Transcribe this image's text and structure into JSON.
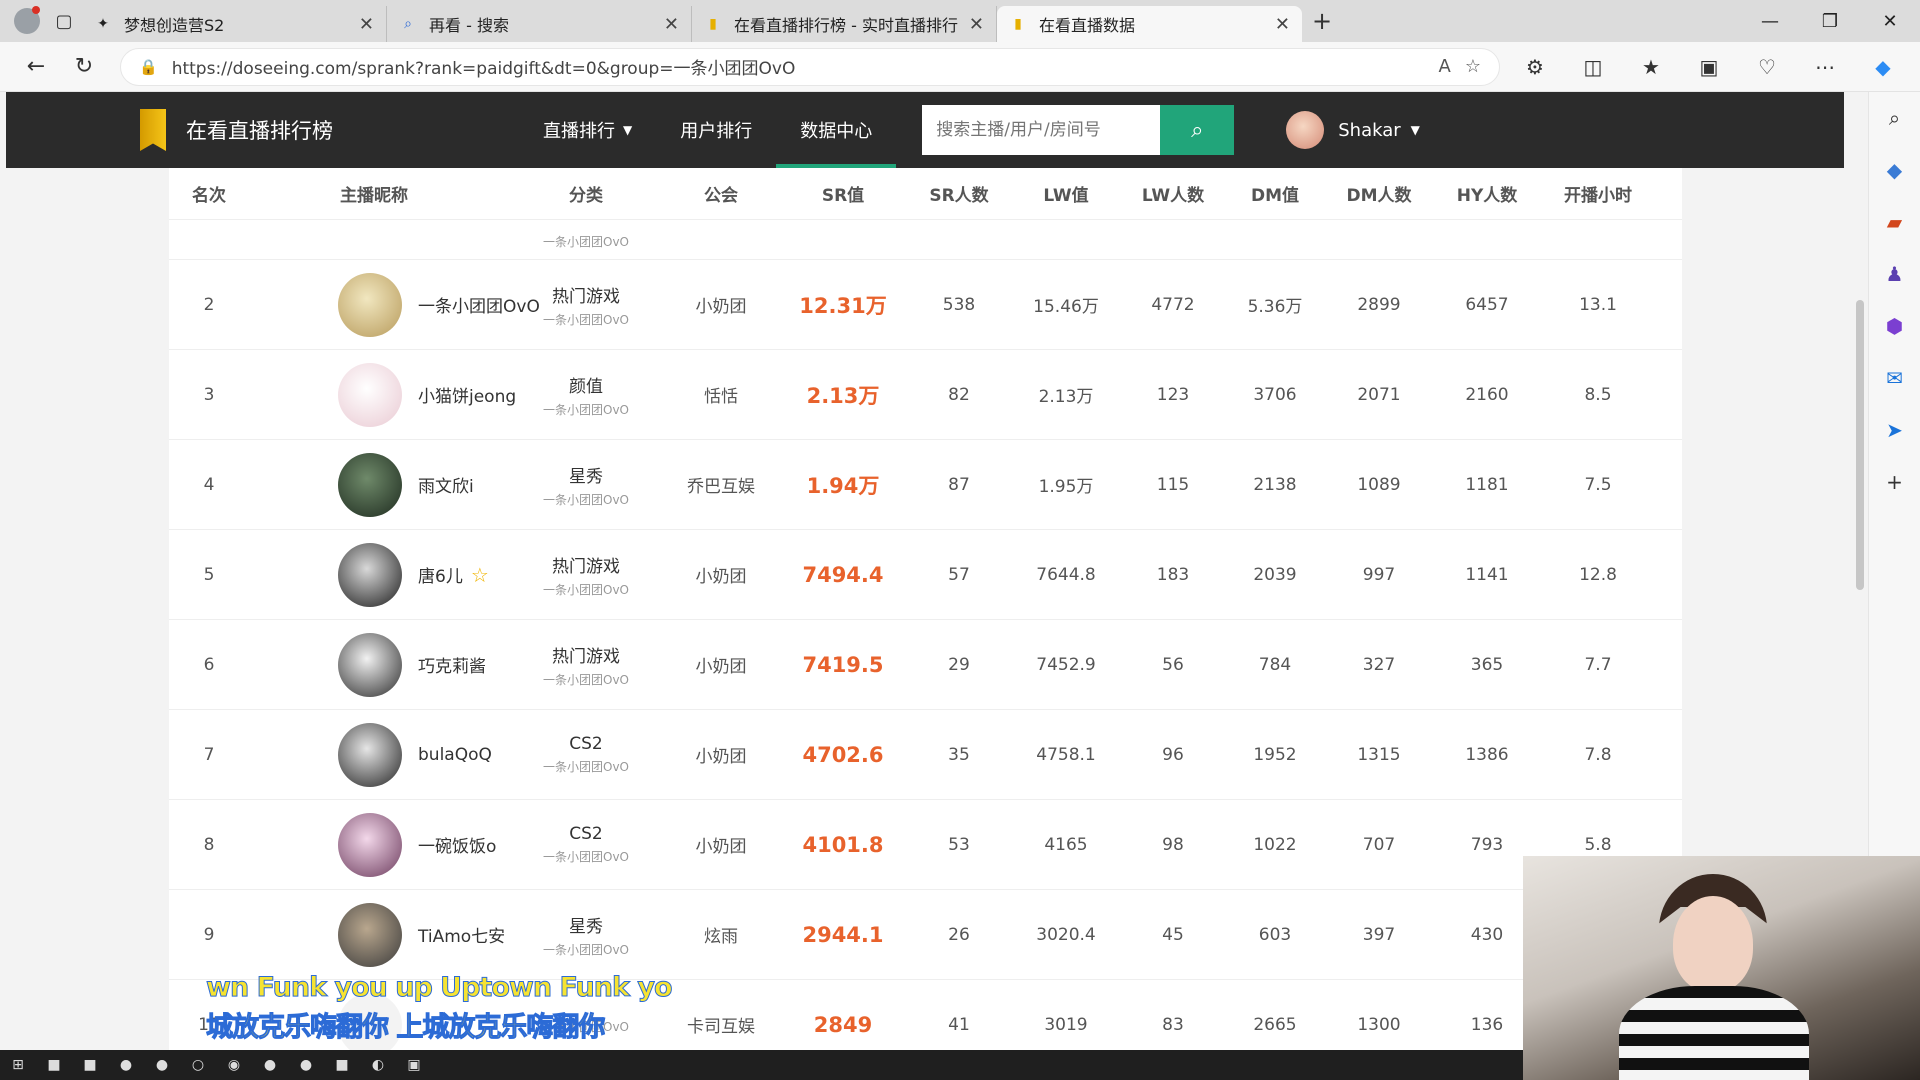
{
  "browser": {
    "tabs": [
      {
        "title": "梦想创造营S2",
        "icon": "game-icon"
      },
      {
        "title": "再看 - 搜索",
        "icon": "search-icon"
      },
      {
        "title": "在看直播排行榜 - 实时直播排行",
        "icon": "bookmark-icon"
      },
      {
        "title": "在看直播数据",
        "icon": "bookmark-icon"
      }
    ],
    "url": "https://doseeing.com/sprank?rank=paidgift&dt=0&group=一条小团团OvO"
  },
  "site": {
    "title": "在看直播排行榜",
    "menu": [
      "直播排行",
      "用户排行",
      "数据中心"
    ],
    "search_placeholder": "搜索主播/用户/房间号",
    "user_name": "Shakar"
  },
  "table": {
    "headers": [
      "名次",
      "主播昵称",
      "分类",
      "公会",
      "SR值",
      "SR人数",
      "LW值",
      "LW人数",
      "DM值",
      "DM人数",
      "HY人数",
      "开播小时"
    ],
    "partial_row_sub": "一条小团团OvO",
    "rows": [
      {
        "rank": "2",
        "name": "一条小团团OvO",
        "cat": "热门游戏",
        "sub": "一条小团团OvO",
        "guild": "小奶团",
        "sr": "12.31万",
        "sr_n": "538",
        "lw": "15.46万",
        "lw_n": "4772",
        "dm": "5.36万",
        "dm_n": "2899",
        "hy": "6457",
        "hours": "13.1",
        "avatar": [
          "#f1e7c0",
          "#b79a5a"
        ]
      },
      {
        "rank": "3",
        "name": "小猫饼jeong",
        "cat": "颜值",
        "sub": "一条小团团OvO",
        "guild": "恬恬",
        "sr": "2.13万",
        "sr_n": "82",
        "lw": "2.13万",
        "lw_n": "123",
        "dm": "3706",
        "dm_n": "2071",
        "hy": "2160",
        "hours": "8.5",
        "avatar": [
          "#ffffff",
          "#e9c9d2"
        ]
      },
      {
        "rank": "4",
        "name": "雨文欣i",
        "cat": "星秀",
        "sub": "一条小团团OvO",
        "guild": "乔巴互娱",
        "sr": "1.94万",
        "sr_n": "87",
        "lw": "1.95万",
        "lw_n": "115",
        "dm": "2138",
        "dm_n": "1089",
        "hy": "1181",
        "hours": "7.5",
        "avatar": [
          "#6f8a6a",
          "#1d2a1e"
        ]
      },
      {
        "rank": "5",
        "name": "唐6儿",
        "star": "☆",
        "cat": "热门游戏",
        "sub": "一条小团团OvO",
        "guild": "小奶团",
        "sr": "7494.4",
        "sr_n": "57",
        "lw": "7644.8",
        "lw_n": "183",
        "dm": "2039",
        "dm_n": "997",
        "hy": "1141",
        "hours": "12.8",
        "avatar": [
          "#d9d9d9",
          "#1a1a1a"
        ]
      },
      {
        "rank": "6",
        "name": "巧克莉酱",
        "cat": "热门游戏",
        "sub": "一条小团团OvO",
        "guild": "小奶团",
        "sr": "7419.5",
        "sr_n": "29",
        "lw": "7452.9",
        "lw_n": "56",
        "dm": "784",
        "dm_n": "327",
        "hy": "365",
        "hours": "7.7",
        "avatar": [
          "#f2f2f2",
          "#2a2a2a"
        ]
      },
      {
        "rank": "7",
        "name": "bulaQoQ",
        "cat": "CS2",
        "sub": "一条小团团OvO",
        "guild": "小奶团",
        "sr": "4702.6",
        "sr_n": "35",
        "lw": "4758.1",
        "lw_n": "96",
        "dm": "1952",
        "dm_n": "1315",
        "hy": "1386",
        "hours": "7.8",
        "avatar": [
          "#e6e6e6",
          "#222222"
        ]
      },
      {
        "rank": "8",
        "name": "一碗饭饭o",
        "cat": "CS2",
        "sub": "一条小团团OvO",
        "guild": "小奶团",
        "sr": "4101.8",
        "sr_n": "53",
        "lw": "4165",
        "lw_n": "98",
        "dm": "1022",
        "dm_n": "707",
        "hy": "793",
        "hours": "5.8",
        "avatar": [
          "#f3d8ea",
          "#6b3a5c"
        ]
      },
      {
        "rank": "9",
        "name": "TiAmo七安",
        "cat": "星秀",
        "sub": "一条小团团OvO",
        "guild": "炫雨",
        "sr": "2944.1",
        "sr_n": "26",
        "lw": "3020.4",
        "lw_n": "45",
        "dm": "603",
        "dm_n": "397",
        "hy": "430",
        "hours": "",
        "avatar": [
          "#b9a78e",
          "#3a3a3a"
        ]
      },
      {
        "rank": "10",
        "name": "",
        "cat": "",
        "sub": "一条小团团OvO",
        "guild": "卡司互娱",
        "sr": "2849",
        "sr_n": "41",
        "lw": "3019",
        "lw_n": "83",
        "dm": "2665",
        "dm_n": "1300",
        "hy": "136",
        "hours": "",
        "avatar": [
          "#f3f3f3",
          "#f3f3f3"
        ]
      }
    ]
  },
  "overlay": {
    "subtitle_line1": "wn Funk you up Uptown Funk yo",
    "subtitle_line2": "城放克乐嗨翻你 上城放克乐嗨翻你"
  }
}
